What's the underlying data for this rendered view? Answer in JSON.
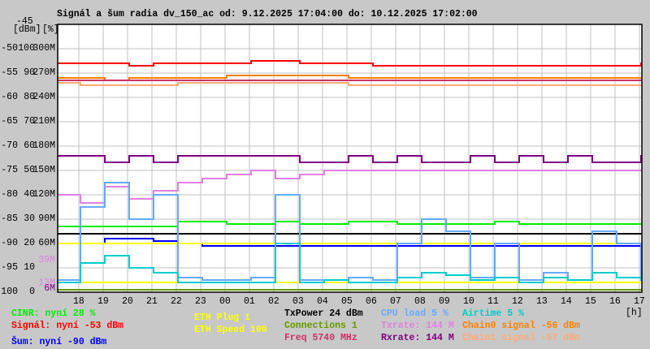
{
  "title": "Signál a šum radia dv_150_ac od: 9.12.2025 17:04:00 do: 10.12.2025 17:02:00",
  "chart_data": {
    "type": "line",
    "title": "Signál a šum radia dv_150_ac od: 9.12.2025 17:04:00 do: 10.12.2025 17:02:00",
    "xlabel": "[h]",
    "ylabel_units": [
      "[dBm]",
      "[%]"
    ],
    "xlim": [
      "9.12.2025 17:04:00",
      "10.12.2025 17:02:00"
    ],
    "ylim_dbm": [
      -100,
      -45
    ],
    "ylim_percent": [
      0,
      100
    ],
    "ylim_rate_M": [
      0,
      300
    ],
    "grid": true,
    "legend_position": "bottom",
    "x_ticks": [
      "18",
      "19",
      "20",
      "21",
      "22",
      "23",
      "00",
      "01",
      "02",
      "03",
      "04",
      "05",
      "06",
      "07",
      "08",
      "09",
      "10",
      "11",
      "12",
      "13",
      "14",
      "15",
      "16",
      "17"
    ],
    "y_ticks_dbm": [
      "-45",
      "-50",
      "-55",
      "-60",
      "-65",
      "-70",
      "-75",
      "-80",
      "-85",
      "-90",
      "-95",
      "-100"
    ],
    "y_ticks_percent": [
      "100",
      "90",
      "80",
      "70",
      "60",
      "50",
      "40",
      "30",
      "20",
      "10",
      "0"
    ],
    "y_ticks_rate": [
      "300M",
      "270M",
      "240M",
      "210M",
      "180M",
      "150M",
      "120M",
      "90M",
      "60M"
    ],
    "extra_rate_labels": [
      {
        "text": "39M",
        "color": "#e080e0"
      },
      {
        "text": "13M",
        "color": "#e080e0"
      },
      {
        "text": "6M",
        "color": "#800080"
      }
    ],
    "x": [
      "17:04",
      "18:00",
      "19:00",
      "20:00",
      "21:00",
      "22:00",
      "23:00",
      "00:00",
      "01:00",
      "02:00",
      "03:00",
      "04:00",
      "05:00",
      "06:00",
      "07:00",
      "08:00",
      "09:00",
      "10:00",
      "11:00",
      "12:00",
      "13:00",
      "14:00",
      "15:00",
      "16:00",
      "17:00"
    ],
    "series": [
      {
        "name": "Signál",
        "axis": "dbm",
        "color": "#ff0000",
        "values": [
          -53,
          -53,
          -53,
          -53.5,
          -53,
          -53,
          -53,
          -53,
          -52.5,
          -52.5,
          -53,
          -53,
          -53,
          -53.5,
          -53.5,
          -53.5,
          -53.5,
          -53.5,
          -53.5,
          -53.5,
          -53.5,
          -53.5,
          -53.5,
          -53.5,
          -53
        ]
      },
      {
        "name": "Chain0 signal",
        "axis": "dbm",
        "color": "#ff8000",
        "values": [
          -56,
          -56,
          -56.5,
          -56,
          -56,
          -56,
          -56,
          -55.5,
          -55.5,
          -55.5,
          -55.5,
          -55.5,
          -56,
          -56,
          -56,
          -56,
          -56,
          -56,
          -56,
          -56,
          -56,
          -56,
          -56,
          -56,
          -56
        ]
      },
      {
        "name": "Chain1 signal",
        "axis": "dbm",
        "color": "#ffaa77",
        "values": [
          -57,
          -57.5,
          -57.5,
          -57.5,
          -57.5,
          -57,
          -57,
          -57,
          -57,
          -57,
          -57,
          -57,
          -57.5,
          -57.5,
          -57.5,
          -57.5,
          -57.5,
          -57.5,
          -57.5,
          -57.5,
          -57.5,
          -57.5,
          -57.5,
          -57.5,
          -57.5
        ]
      },
      {
        "name": "Freq",
        "axis": "dbm",
        "color": "#cc3366",
        "values": [
          -56.5,
          -56.5,
          -56.5,
          -56.5,
          -56.5,
          -56.5,
          -56.5,
          -56.5,
          -56.5,
          -56.5,
          -56.5,
          -56.5,
          -56.5,
          -56.5,
          -56.5,
          -56.5,
          -56.5,
          -56.5,
          -56.5,
          -56.5,
          -56.5,
          -56.5,
          -56.5,
          -56.5,
          -56.5
        ]
      },
      {
        "name": "Šum",
        "axis": "dbm",
        "color": "#0000ff",
        "values": [
          -90,
          -90,
          -89,
          -89,
          -89.5,
          -90,
          -90.5,
          -90.5,
          -90.5,
          -90.5,
          -90.5,
          -90.5,
          -90.5,
          -90.5,
          -90.5,
          -90.5,
          -90.5,
          -90.5,
          -90.5,
          -90.5,
          -90.5,
          -90.5,
          -90.5,
          -90.5,
          -90
        ]
      },
      {
        "name": "Rxrate",
        "axis": "rate",
        "color": "#800080",
        "values": [
          168,
          168,
          160,
          168,
          160,
          168,
          168,
          168,
          168,
          168,
          160,
          160,
          168,
          160,
          168,
          160,
          160,
          168,
          160,
          168,
          160,
          168,
          160,
          160,
          168
        ]
      },
      {
        "name": "Txrate",
        "axis": "rate",
        "color": "#e080e0",
        "values": [
          120,
          110,
          130,
          115,
          125,
          135,
          140,
          145,
          150,
          140,
          145,
          150,
          150,
          150,
          150,
          150,
          150,
          150,
          150,
          150,
          150,
          150,
          150,
          150,
          150
        ]
      },
      {
        "name": "CINR",
        "axis": "percent",
        "color": "#00ee00",
        "values": [
          27,
          27,
          27,
          27,
          27,
          29,
          29,
          28,
          28,
          29,
          28,
          28,
          29,
          29,
          28,
          28,
          28,
          28,
          29,
          28,
          28,
          28,
          28,
          28,
          28
        ]
      },
      {
        "name": "TxPower",
        "axis": "percent",
        "color": "#000000",
        "values": [
          24,
          24,
          24,
          24,
          24,
          24,
          24,
          24,
          24,
          24,
          24,
          24,
          24,
          24,
          24,
          24,
          24,
          24,
          24,
          24,
          24,
          24,
          24,
          24,
          24
        ]
      },
      {
        "name": "ETH Plug",
        "axis": "percent",
        "color": "#ffff00",
        "values": [
          20,
          20,
          20,
          20,
          20,
          20,
          20,
          20,
          20,
          20,
          20,
          20,
          20,
          20,
          20,
          20,
          20,
          20,
          20,
          20,
          20,
          20,
          20,
          20,
          20
        ]
      },
      {
        "name": "ETH Speed",
        "axis": "percent",
        "color": "#ffff00",
        "values": [
          4,
          4,
          4,
          4,
          4,
          4,
          4,
          4,
          4,
          4,
          4,
          4,
          4,
          4,
          4,
          4,
          4,
          4,
          4,
          4,
          4,
          4,
          4,
          4,
          4
        ]
      },
      {
        "name": "CPU load",
        "axis": "percent",
        "color": "#66aaff",
        "values": [
          5,
          35,
          45,
          30,
          40,
          6,
          5,
          5,
          6,
          40,
          5,
          5,
          6,
          5,
          20,
          30,
          25,
          6,
          20,
          5,
          8,
          5,
          25,
          20,
          5
        ]
      },
      {
        "name": "Airtime",
        "axis": "percent",
        "color": "#00cccc",
        "values": [
          4,
          12,
          15,
          10,
          8,
          4,
          4,
          4,
          4,
          20,
          4,
          5,
          4,
          4,
          6,
          8,
          7,
          5,
          6,
          4,
          6,
          5,
          8,
          6,
          5
        ]
      },
      {
        "name": "Connections",
        "axis": "percent",
        "color": "#669900",
        "values": [
          1,
          1,
          1,
          1,
          1,
          1,
          1,
          1,
          1,
          1,
          1,
          1,
          1,
          1,
          1,
          1,
          1,
          1,
          1,
          1,
          1,
          1,
          1,
          1,
          1
        ]
      }
    ]
  },
  "legend": {
    "cinr": {
      "text": "CINR: nyní 28 %",
      "color": "#00ee00"
    },
    "signal": {
      "text": "Signál: nyní -53 dBm",
      "color": "#ff0000"
    },
    "noise": {
      "text": "Šum: nyní -90 dBm",
      "color": "#0000ff"
    },
    "eth_plug": {
      "text": "ETH Plug 1",
      "color": "#ffff00"
    },
    "eth_speed": {
      "text": "ETH Speed 100",
      "color": "#ffff00"
    },
    "txpower": {
      "text": "TxPower 24 dBm",
      "color": "#000000"
    },
    "connections": {
      "text": "Connections 1",
      "color": "#669900"
    },
    "freq": {
      "text": "Freq 5740 MHz",
      "color": "#cc3366"
    },
    "cpu": {
      "text": "CPU load 5 %",
      "color": "#66aaff"
    },
    "txrate": {
      "text": "Txrate: 144 M",
      "color": "#e080e0"
    },
    "rxrate": {
      "text": "Rxrate: 144 M",
      "color": "#800080"
    },
    "airtime": {
      "text": "Airtime 5 %",
      "color": "#00cccc"
    },
    "chain0": {
      "text": "Chain0 signal -56 dBm",
      "color": "#ff8000"
    },
    "chain1": {
      "text": "Chain1 signal -57 dBm",
      "color": "#ffaa77"
    }
  }
}
